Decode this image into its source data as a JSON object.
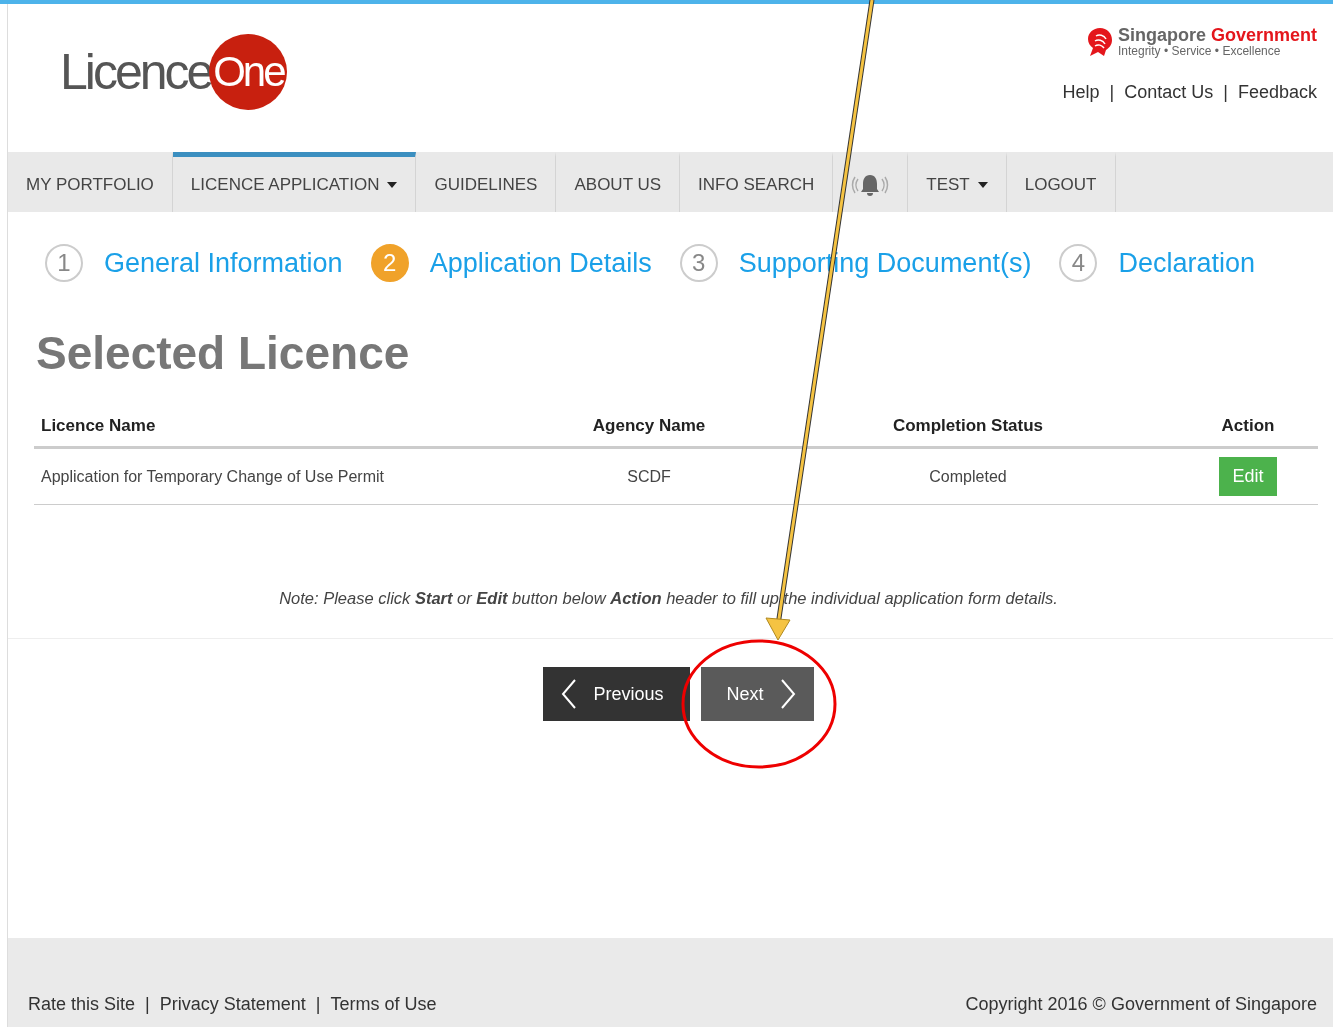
{
  "logo": {
    "word": "Licence",
    "badge": "One"
  },
  "gov_brand": {
    "first": "Singapore",
    "second": "Government",
    "tagline": "Integrity • Service • Excellence"
  },
  "top_links": [
    "Help",
    "Contact Us",
    "Feedback"
  ],
  "link_separator": "|",
  "nav": [
    {
      "kind": "text",
      "label": "MY PORTFOLIO",
      "dropdown": false,
      "selected": false
    },
    {
      "kind": "text",
      "label": "LICENCE APPLICATION",
      "dropdown": true,
      "selected": true
    },
    {
      "kind": "text",
      "label": "GUIDELINES",
      "dropdown": false,
      "selected": false
    },
    {
      "kind": "text",
      "label": "ABOUT US",
      "dropdown": false,
      "selected": false
    },
    {
      "kind": "text",
      "label": "INFO SEARCH",
      "dropdown": false,
      "selected": false
    },
    {
      "kind": "bell",
      "dropdown": false,
      "selected": false
    },
    {
      "kind": "text",
      "label": "TEST",
      "dropdown": true,
      "selected": false
    },
    {
      "kind": "text",
      "label": "LOGOUT",
      "dropdown": false,
      "selected": false
    }
  ],
  "steps": [
    {
      "number": "1",
      "label": "General Information",
      "selected": false
    },
    {
      "number": "2",
      "label": "Application Details",
      "selected": true
    },
    {
      "number": "3",
      "label": "Supporting Document(s)",
      "selected": false
    },
    {
      "number": "4",
      "label": "Declaration",
      "selected": false
    }
  ],
  "heading": "Selected Licence",
  "table": {
    "columns": [
      "Licence Name",
      "Agency Name",
      "Completion Status",
      "Action"
    ],
    "rows": [
      {
        "licence_name": "Application for Temporary Change of Use Permit",
        "agency_name": "SCDF",
        "completion_status": "Completed",
        "action": "Edit"
      }
    ]
  },
  "note": "Note: Please click **Start** or **Edit** button below **Action** header to fill up the individual application form details.",
  "buttons": {
    "previous": "Previous",
    "next": "Next"
  },
  "footer": {
    "links": [
      "Rate this Site",
      "Privacy Statement",
      "Terms of Use"
    ],
    "copyright": "Copyright 2016 © Government of Singapore"
  }
}
